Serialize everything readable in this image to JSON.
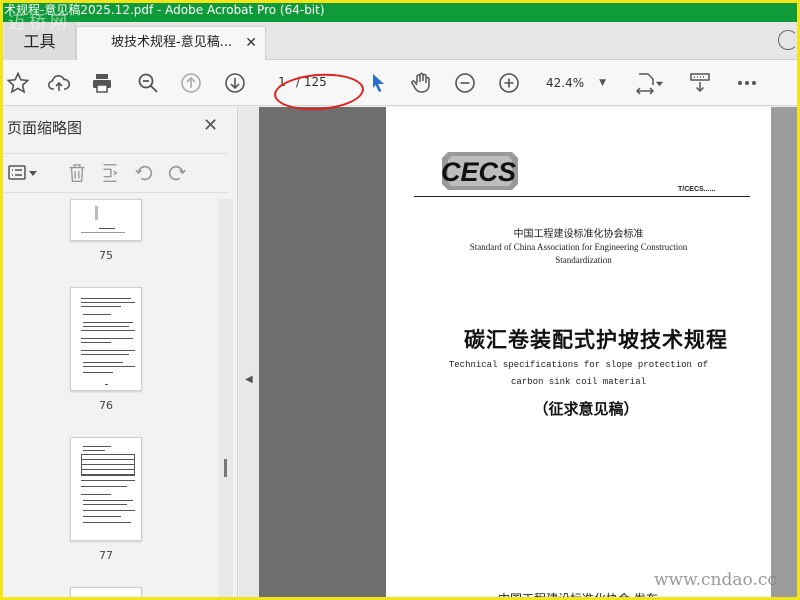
{
  "window": {
    "title": "术规程-意见稿2025.12.pdf - Adobe Acrobat Pro (64-bit)",
    "watermark_top_left": "迈桥网"
  },
  "tabs": {
    "tools_label": "工具",
    "document_tab_label": "坡技术规程-意见稿...",
    "close_glyph": "✕"
  },
  "toolbar": {
    "icons": [
      "bookmark-star-icon",
      "upload-cloud-icon",
      "print-icon",
      "zoom-search-icon",
      "page-up-icon",
      "page-down-icon",
      "select-pointer-icon",
      "hand-tool-icon",
      "zoom-out-icon",
      "zoom-in-icon",
      "fit-page-icon",
      "scroll-mode-icon",
      "more-icon"
    ],
    "current_page": "1",
    "total_pages": "/ 125",
    "zoom": "42.4%",
    "annotation_color": "#e0201b"
  },
  "sidebar": {
    "title": "页面缩略图",
    "close_glyph": "✕",
    "thumbnails": [
      {
        "page": "75"
      },
      {
        "page": "76"
      },
      {
        "page": "77"
      }
    ]
  },
  "document": {
    "logo_text": "CECS",
    "standard_code": "T/CECS......",
    "association_cn": "中国工程建设标准化协会标准",
    "association_en_line1": "Standard of China Association for Engineering Construction",
    "association_en_line2": "Standardization",
    "title_cn": "碳汇卷装配式护坡技术规程",
    "title_en_line1": "Technical specifications for slope protection of",
    "title_en_line2": "carbon sink coil material",
    "draft_label": "（征求意见稿）",
    "publisher": "中国工程建设标准化协会 发布"
  },
  "overlay": {
    "watermark_bottom_right": "www.cndao.cc"
  },
  "colors": {
    "titlebar": "#0f9b3a",
    "frame": "#f2e61a",
    "doc_background": "#6e6e6e"
  }
}
